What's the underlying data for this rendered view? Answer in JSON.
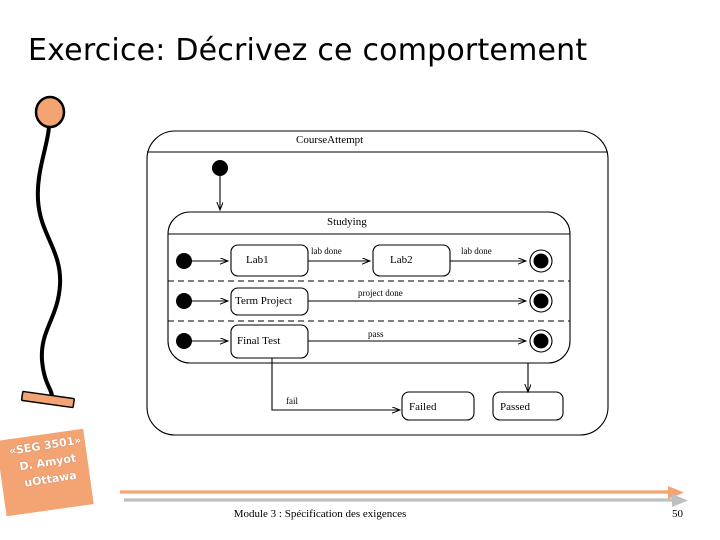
{
  "slide": {
    "title": "Exercice: Décrivez ce comportement",
    "page_number": "50",
    "footer": "Module 3 : Spécification des exigences"
  },
  "stamp": {
    "line1": "«SEG 3501»",
    "line2": "D. Amyot",
    "line3": "uOttawa",
    "color": "#F4A373"
  },
  "colors": {
    "accent_orange": "#F4A373",
    "footer_gray": "#BFBFBF",
    "stroke": "#000000",
    "background": "#FFFFFF"
  },
  "diagram": {
    "type": "uml-state-machine",
    "outer_state": {
      "name": "CourseAttempt"
    },
    "composite_state": {
      "name": "Studying"
    },
    "regions": [
      {
        "id": "region-labs",
        "states": [
          {
            "name": "Lab1"
          },
          {
            "name": "Lab2"
          }
        ],
        "transitions": [
          {
            "label": "lab done",
            "from": "Lab1",
            "to": "Lab2"
          },
          {
            "label": "lab done",
            "from": "Lab2",
            "to": "final"
          }
        ],
        "has_initial": true,
        "has_final": true
      },
      {
        "id": "region-project",
        "states": [
          {
            "name": "Term Project"
          }
        ],
        "transitions": [
          {
            "label": "project done",
            "from": "Term Project",
            "to": "final"
          }
        ],
        "has_initial": true,
        "has_final": true
      },
      {
        "id": "region-exam",
        "states": [
          {
            "name": "Final Test"
          }
        ],
        "transitions": [
          {
            "label": "pass",
            "from": "Final Test",
            "to": "final"
          },
          {
            "label": "fail",
            "from": "Final Test",
            "to": "Failed"
          }
        ],
        "has_initial": true,
        "has_final": true
      }
    ],
    "outcome_states": [
      {
        "name": "Failed"
      },
      {
        "name": "Passed"
      }
    ]
  },
  "decoration": {
    "squiggle_head": "orange-circle",
    "squiggle_foot": "orange-bar"
  }
}
